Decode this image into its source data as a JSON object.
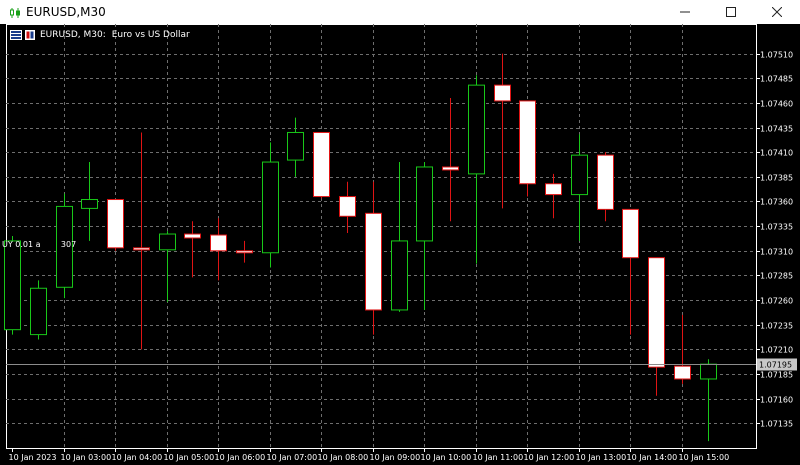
{
  "window": {
    "title": "EURUSD,M30",
    "controls": {
      "minimize": "—",
      "maximize": "☐",
      "close": "✕"
    }
  },
  "chart_header": {
    "symbol_timeframe": "EURUSD, M30:",
    "description": "Euro vs US Dollar"
  },
  "trade_line_text": "UY 0.01 a        307",
  "current_price": "1.07195",
  "colors": {
    "background": "#000000",
    "grid": "#6e6e6e",
    "bull_body": "#000000",
    "bull_outline": "#19c819",
    "bear_body": "#ffffff",
    "bear_outline": "#e01414",
    "axis_text": "#ffffff",
    "price_label_bg": "#c8c8c8",
    "price_label_text": "#000000",
    "bid_line": "#8c8c8c"
  },
  "chart_data": {
    "type": "candlestick",
    "symbol": "EURUSD",
    "timeframe": "M30",
    "ylim": [
      1.0711,
      1.0754
    ],
    "yticks": [
      "1.07510",
      "1.07485",
      "1.07460",
      "1.07435",
      "1.07410",
      "1.07385",
      "1.07360",
      "1.07335",
      "1.07310",
      "1.07285",
      "1.07260",
      "1.07235",
      "1.07210",
      "1.07185",
      "1.07160",
      "1.07135"
    ],
    "xtick_labels": [
      "10 Jan 2023",
      "10 Jan 03:00",
      "10 Jan 04:00",
      "10 Jan 05:00",
      "10 Jan 06:00",
      "10 Jan 07:00",
      "10 Jan 08:00",
      "10 Jan 09:00",
      "10 Jan 10:00",
      "10 Jan 11:00",
      "10 Jan 12:00",
      "10 Jan 13:00",
      "10 Jan 14:00",
      "10 Jan 15:00"
    ],
    "grid": true,
    "candles": [
      {
        "o": 1.0723,
        "h": 1.07325,
        "l": 1.07225,
        "c": 1.0732
      },
      {
        "o": 1.07225,
        "h": 1.0728,
        "l": 1.0722,
        "c": 1.07272
      },
      {
        "o": 1.07273,
        "h": 1.07368,
        "l": 1.07262,
        "c": 1.07355
      },
      {
        "o": 1.07353,
        "h": 1.074,
        "l": 1.0732,
        "c": 1.07362
      },
      {
        "o": 1.07362,
        "h": 1.07362,
        "l": 1.0731,
        "c": 1.07313
      },
      {
        "o": 1.07313,
        "h": 1.0743,
        "l": 1.0721,
        "c": 1.07311
      },
      {
        "o": 1.07311,
        "h": 1.0733,
        "l": 1.07258,
        "c": 1.07327
      },
      {
        "o": 1.07327,
        "h": 1.0734,
        "l": 1.07283,
        "c": 1.07323
      },
      {
        "o": 1.07326,
        "h": 1.07343,
        "l": 1.0728,
        "c": 1.0731
      },
      {
        "o": 1.0731,
        "h": 1.0732,
        "l": 1.07298,
        "c": 1.07308
      },
      {
        "o": 1.07308,
        "h": 1.0742,
        "l": 1.07293,
        "c": 1.074
      },
      {
        "o": 1.07402,
        "h": 1.07445,
        "l": 1.07385,
        "c": 1.0743
      },
      {
        "o": 1.0743,
        "h": 1.0743,
        "l": 1.07363,
        "c": 1.07365
      },
      {
        "o": 1.07365,
        "h": 1.0738,
        "l": 1.07328,
        "c": 1.07345
      },
      {
        "o": 1.07348,
        "h": 1.0738,
        "l": 1.07225,
        "c": 1.0725
      },
      {
        "o": 1.0725,
        "h": 1.074,
        "l": 1.07248,
        "c": 1.0732
      },
      {
        "o": 1.0732,
        "h": 1.074,
        "l": 1.0725,
        "c": 1.07395
      },
      {
        "o": 1.07395,
        "h": 1.07465,
        "l": 1.0734,
        "c": 1.07392
      },
      {
        "o": 1.07388,
        "h": 1.07488,
        "l": 1.07297,
        "c": 1.07478
      },
      {
        "o": 1.07478,
        "h": 1.0751,
        "l": 1.07353,
        "c": 1.07462
      },
      {
        "o": 1.07462,
        "h": 1.07462,
        "l": 1.07365,
        "c": 1.07378
      },
      {
        "o": 1.07378,
        "h": 1.07388,
        "l": 1.07343,
        "c": 1.07367
      },
      {
        "o": 1.07367,
        "h": 1.07428,
        "l": 1.0732,
        "c": 1.07407
      },
      {
        "o": 1.07407,
        "h": 1.0741,
        "l": 1.0734,
        "c": 1.07352
      },
      {
        "o": 1.07352,
        "h": 1.07352,
        "l": 1.07225,
        "c": 1.07303
      },
      {
        "o": 1.07303,
        "h": 1.07303,
        "l": 1.07163,
        "c": 1.07192
      },
      {
        "o": 1.07193,
        "h": 1.07245,
        "l": 1.07175,
        "c": 1.0718
      },
      {
        "o": 1.0718,
        "h": 1.072,
        "l": 1.07117,
        "c": 1.07195
      }
    ],
    "bid": 1.07195
  }
}
